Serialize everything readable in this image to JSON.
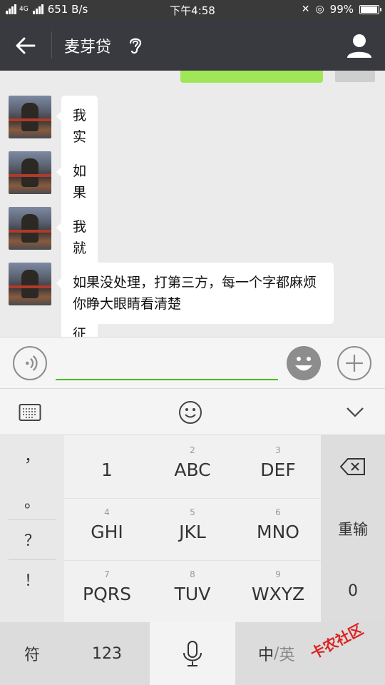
{
  "status_bar": {
    "signal_1": "",
    "network_label": "4G",
    "speed": "651 B/s",
    "time": "下午4:58",
    "battery": "99%"
  },
  "header": {
    "title": "麦芽贷"
  },
  "messages": [
    {
      "text": "我实话给你说"
    },
    {
      "text": "如果我下班之前没解决"
    },
    {
      "text": "我就给你上征信"
    },
    {
      "text": "如果没处理，打第三方，每一个字都麻烦你睁大眼睛看清楚"
    }
  ],
  "input": {
    "value": "",
    "placeholder": ""
  },
  "keyboard": {
    "punctuation": [
      "，",
      "。",
      "？",
      "！"
    ],
    "keys": [
      {
        "num": "",
        "label": "1"
      },
      {
        "num": "2",
        "label": "ABC"
      },
      {
        "num": "3",
        "label": "DEF"
      },
      {
        "num": "4",
        "label": "GHI"
      },
      {
        "num": "5",
        "label": "JKL"
      },
      {
        "num": "6",
        "label": "MNO"
      },
      {
        "num": "7",
        "label": "PQRS"
      },
      {
        "num": "8",
        "label": "TUV"
      },
      {
        "num": "9",
        "label": "WXYZ"
      }
    ],
    "reinput": "重输",
    "zero": "0",
    "symbol": "符",
    "num_mode": "123",
    "lang_zh": "中",
    "lang_sep": "/",
    "lang_en": "英"
  },
  "watermark": "卡农社区",
  "colors": {
    "accent_green": "#45c01a",
    "bubble_self": "#9fe658",
    "titlebar": "#393a3f"
  }
}
